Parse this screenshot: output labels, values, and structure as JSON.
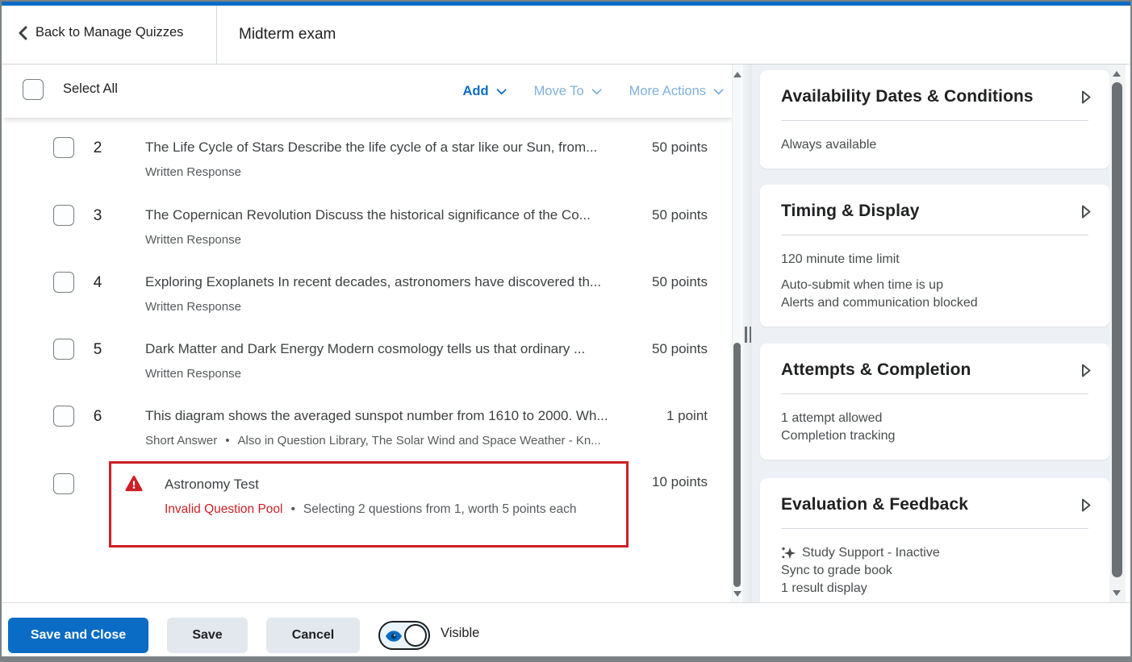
{
  "header": {
    "back_label": "Back to Manage Quizzes",
    "title": "Midterm exam"
  },
  "toolbar": {
    "select_all_label": "Select All",
    "add_label": "Add",
    "move_to_label": "Move To",
    "more_actions_label": "More Actions"
  },
  "misc": {
    "bullet": "•"
  },
  "questions": [
    {
      "number": "2",
      "title": "The Life Cycle of Stars Describe the life cycle of a star like our Sun, from...",
      "points": "50 points",
      "type": "Written Response"
    },
    {
      "number": "3",
      "title": "The Copernican Revolution Discuss the historical significance of the Co...",
      "points": "50 points",
      "type": "Written Response"
    },
    {
      "number": "4",
      "title": "Exploring Exoplanets In recent decades, astronomers have discovered th...",
      "points": "50 points",
      "type": "Written Response"
    },
    {
      "number": "5",
      "title": "Dark Matter and Dark Energy Modern cosmology tells us that ordinary ...",
      "points": "50 points",
      "type": "Written Response"
    },
    {
      "number": "6",
      "title": "This diagram shows the averaged sunspot number from 1610 to 2000. Wh...",
      "points": "1 point",
      "type": "Short Answer",
      "also": "Also in Question Library, The Solar Wind and Space Weather - Kn..."
    }
  ],
  "pool_row": {
    "title": "Astronomy Test",
    "error": "Invalid Question Pool",
    "detail": "Selecting 2 questions from 1, worth 5 points each",
    "points": "10 points"
  },
  "sidebar": {
    "availability": {
      "title": "Availability Dates & Conditions",
      "line1": "Always available"
    },
    "timing": {
      "title": "Timing & Display",
      "line1": "120 minute time limit",
      "line2": "Auto-submit when time is up",
      "line3": "Alerts and communication blocked"
    },
    "attempts": {
      "title": "Attempts & Completion",
      "line1": "1 attempt allowed",
      "line2": "Completion tracking"
    },
    "evaluation": {
      "title": "Evaluation & Feedback",
      "line1": "Study Support - Inactive",
      "line2": "Sync to grade book",
      "line3": "1 result display"
    }
  },
  "footer": {
    "save_and_close_label": "Save and Close",
    "save_label": "Save",
    "cancel_label": "Cancel",
    "visible_label": "Visible"
  },
  "colors": {
    "accent_blue": "#0a6cc4",
    "disabled_link_blue": "#7fb0dd",
    "error_red": "#cd2026",
    "text_primary": "#202122",
    "text_secondary": "#565a5c",
    "sidebar_bg": "#edf1f5",
    "button_gray": "#e3e8ee"
  }
}
